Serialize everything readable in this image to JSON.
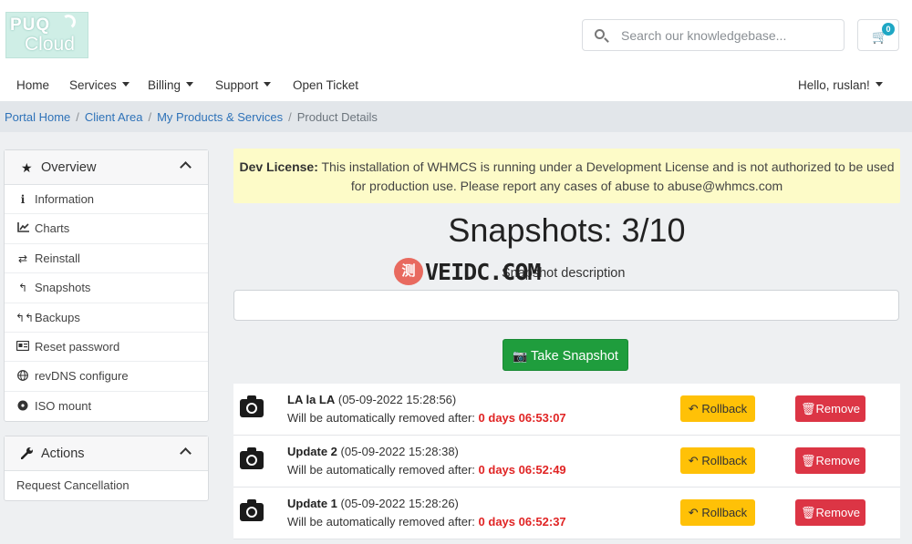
{
  "brand": {
    "logo_line1": "PUQ",
    "logo_line2": "Cloud"
  },
  "search": {
    "placeholder": "Search our knowledgebase..."
  },
  "cart": {
    "count": "0"
  },
  "nav": {
    "items": [
      {
        "label": "Home"
      },
      {
        "label": "Services"
      },
      {
        "label": "Billing"
      },
      {
        "label": "Support"
      },
      {
        "label": "Open Ticket"
      }
    ],
    "user_greeting": "Hello, ruslan!"
  },
  "breadcrumb": {
    "links": [
      "Portal Home",
      "Client Area",
      "My Products & Services"
    ],
    "current": "Product Details",
    "separator": "/"
  },
  "sidebar": {
    "overview": {
      "title": "Overview",
      "items": [
        {
          "label": "Information",
          "icon": "info-icon"
        },
        {
          "label": "Charts",
          "icon": "chart-icon"
        },
        {
          "label": "Reinstall",
          "icon": "retweet-icon"
        },
        {
          "label": "Snapshots",
          "icon": "reply-icon"
        },
        {
          "label": "Backups",
          "icon": "reply-all-icon"
        },
        {
          "label": "Reset password",
          "icon": "id-card-icon"
        },
        {
          "label": "revDNS configure",
          "icon": "globe-icon"
        },
        {
          "label": "ISO mount",
          "icon": "disc-icon"
        }
      ]
    },
    "actions": {
      "title": "Actions",
      "items": [
        {
          "label": "Request Cancellation"
        }
      ]
    }
  },
  "alert": {
    "strong": "Dev License:",
    "text": " This installation of WHMCS is running under a Development License and is not authorized to be used for production use. Please report any cases of abuse to abuse@whmcs.com"
  },
  "snapshots": {
    "title": "Snapshots: 3/10",
    "description_label": "Snapshot description",
    "description_value": "",
    "take_button": "Take Snapshot",
    "expire_prefix": "Will be automatically removed after: ",
    "rollback_label": "Rollback",
    "remove_label": "Remove",
    "list": [
      {
        "name": "LA la LA",
        "date": " (05-09-2022 15:28:56)",
        "remaining": "0 days 06:53:07"
      },
      {
        "name": "Update 2",
        "date": " (05-09-2022 15:28:38)",
        "remaining": "0 days 06:52:49"
      },
      {
        "name": "Update 1",
        "date": " (05-09-2022 15:28:26)",
        "remaining": "0 days 06:52:37"
      }
    ]
  },
  "watermark": {
    "circle": "测",
    "text": "VEIDC.COM"
  },
  "colors": {
    "link": "#2e72b8",
    "success": "#1f9d3d",
    "warning": "#ffc107",
    "danger": "#dc3545",
    "alert_bg": "#fdfbc8",
    "countdown": "#e02424"
  }
}
